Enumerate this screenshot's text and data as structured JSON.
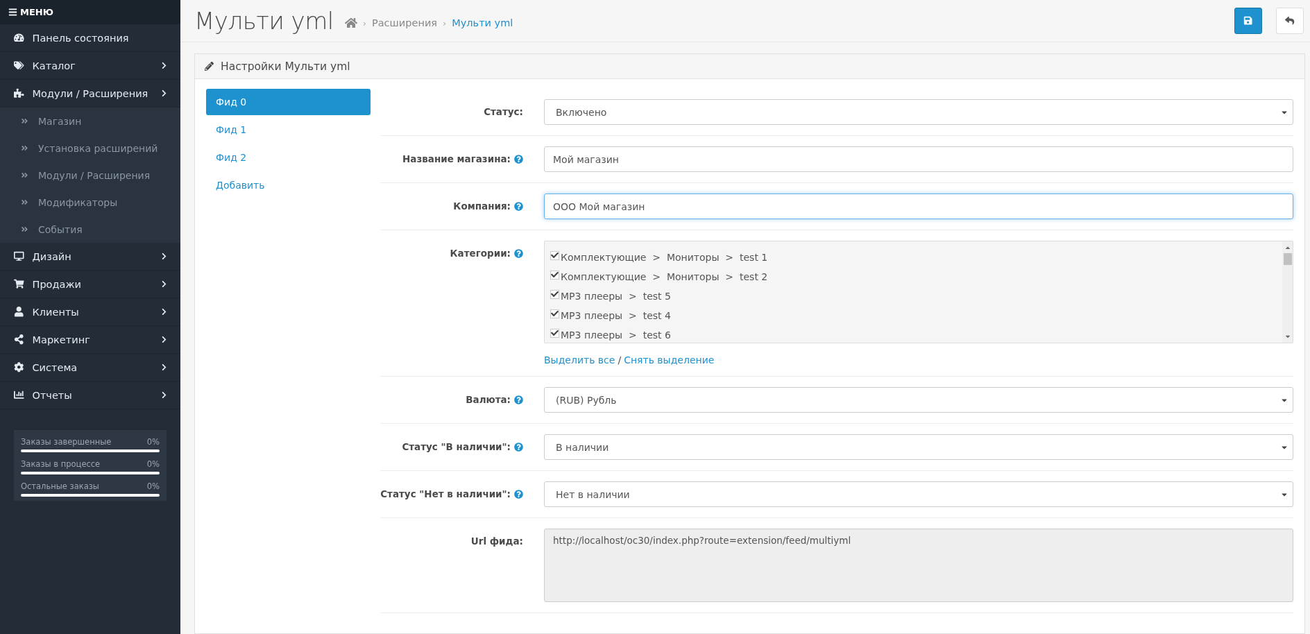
{
  "sidebar": {
    "menu_label": "МЕНЮ",
    "items": [
      {
        "label": "Панель состояния",
        "kind": "link"
      },
      {
        "label": "Каталог",
        "kind": "group"
      },
      {
        "label": "Модули / Расширения",
        "kind": "group",
        "children": [
          {
            "label": "Магазин"
          },
          {
            "label": "Установка расширений"
          },
          {
            "label": "Модули / Расширения"
          },
          {
            "label": "Модификаторы"
          },
          {
            "label": "События"
          }
        ]
      },
      {
        "label": "Дизайн",
        "kind": "group"
      },
      {
        "label": "Продажи",
        "kind": "group"
      },
      {
        "label": "Клиенты",
        "kind": "group"
      },
      {
        "label": "Маркетинг",
        "kind": "group"
      },
      {
        "label": "Система",
        "kind": "group"
      },
      {
        "label": "Отчеты",
        "kind": "group"
      }
    ],
    "stats": [
      {
        "label": "Заказы завершенные",
        "value": "0%",
        "level": 0
      },
      {
        "label": "Заказы в процессе",
        "value": "0%",
        "level": 0
      },
      {
        "label": "Остальные заказы",
        "value": "0%",
        "level": 0
      }
    ]
  },
  "header": {
    "title": "Мульти yml",
    "breadcrumbs": [
      {
        "separator": "›",
        "label": "Расширения",
        "active": false
      },
      {
        "separator": "›",
        "label": "Мульти yml",
        "active": true
      }
    ]
  },
  "panel": {
    "title": "Настройки Мульти yml",
    "feeds": [
      {
        "label": "Фид 0",
        "selected": true
      },
      {
        "label": "Фид 1",
        "selected": false
      },
      {
        "label": "Фид 2",
        "selected": false
      }
    ],
    "add_link": "Добавить",
    "fields": [
      {
        "kind": "select",
        "label": "Статус:",
        "value": "Включено"
      },
      {
        "kind": "text",
        "label": "Название магазина:",
        "help": true,
        "value": "Мой магазин",
        "focused": false
      },
      {
        "kind": "text",
        "label": "Компания:",
        "help": true,
        "value": "ООО Мой магазин",
        "focused": true
      },
      {
        "kind": "checklist",
        "label": "Категории:",
        "help": true,
        "items": [
          {
            "label": "Комплектующие  >  Мониторы  >  test 1",
            "checked": true
          },
          {
            "label": "Комплектующие  >  Мониторы  >  test 2",
            "checked": true
          },
          {
            "label": "MP3 плееры  >  test 5",
            "checked": true
          },
          {
            "label": "MP3 плееры  >  test 4",
            "checked": true
          },
          {
            "label": "MP3 плееры  >  test 6",
            "checked": true
          }
        ],
        "select_all": "Выделить все",
        "separator": "/",
        "deselect_all": "Снять выделение"
      },
      {
        "kind": "select",
        "label": "Валюта:",
        "help": true,
        "value": "(RUB) Рубль"
      },
      {
        "kind": "select",
        "label": "Статус \"В наличии\":",
        "help": true,
        "value": "В наличии"
      },
      {
        "kind": "select",
        "label": "Статус \"Нет в наличии\":",
        "help": true,
        "value": "Нет в наличии"
      },
      {
        "kind": "textarea",
        "label": "Url фида:",
        "value": "http://localhost/oc30/index.php?route=extension/feed/multiyml"
      }
    ]
  }
}
